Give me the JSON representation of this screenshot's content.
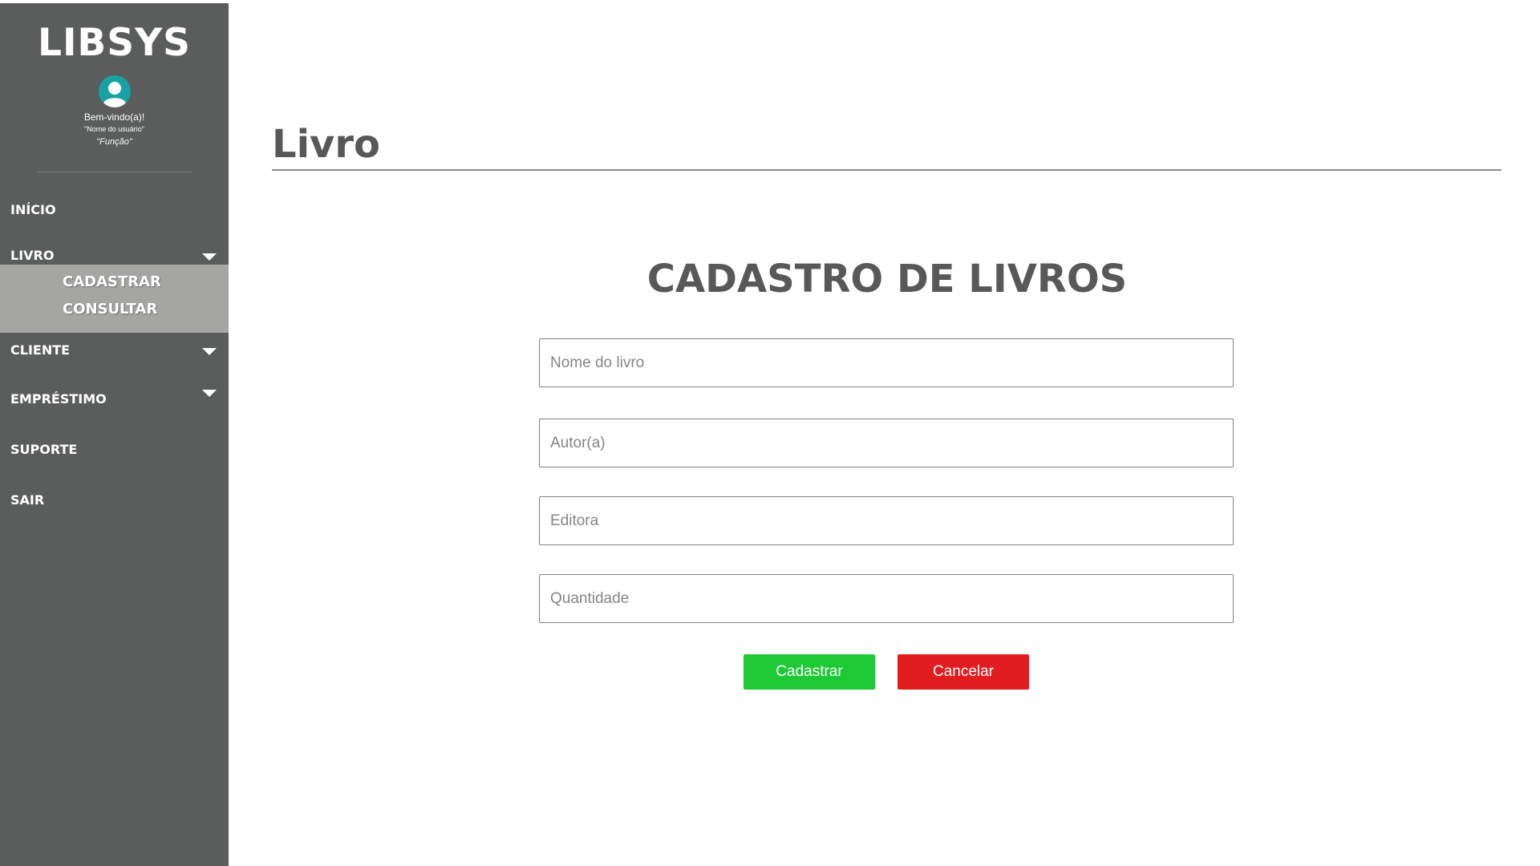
{
  "sidebar": {
    "logo": "LIBSYS",
    "welcome": "Bem-vindo(a)!",
    "user_name": "\"Nome do usuário\"",
    "user_role": "\"Função\"",
    "nav": {
      "inicio": "INÍCIO",
      "livro": "LIVRO",
      "cliente": "CLIENTE",
      "emprestimo": "EMPRÉSTIMO",
      "suporte": "SUPORTE",
      "sair": "SAIR"
    },
    "livro_submenu": [
      "CADASTRAR",
      "CONSULTAR"
    ]
  },
  "main": {
    "page_title": "Livro",
    "form_title": "CADASTRO DE LIVROS",
    "fields": {
      "nome": {
        "placeholder": "Nome do livro",
        "value": ""
      },
      "autor": {
        "placeholder": "Autor(a)",
        "value": ""
      },
      "editora": {
        "placeholder": "Editora",
        "value": ""
      },
      "quantidade": {
        "placeholder": "Quantidade",
        "value": ""
      }
    },
    "buttons": {
      "submit": "Cadastrar",
      "cancel": "Cancelar"
    }
  },
  "colors": {
    "sidebar_bg": "#5b5d5c",
    "submenu_bg": "#a5a5a4",
    "avatar": "#17a3a6",
    "primary_button": "#1ec936",
    "cancel_button": "#e21d1f",
    "heading_text": "#585858"
  },
  "icons": {
    "avatar": "user-avatar-icon",
    "expand": "caret-down-icon"
  }
}
